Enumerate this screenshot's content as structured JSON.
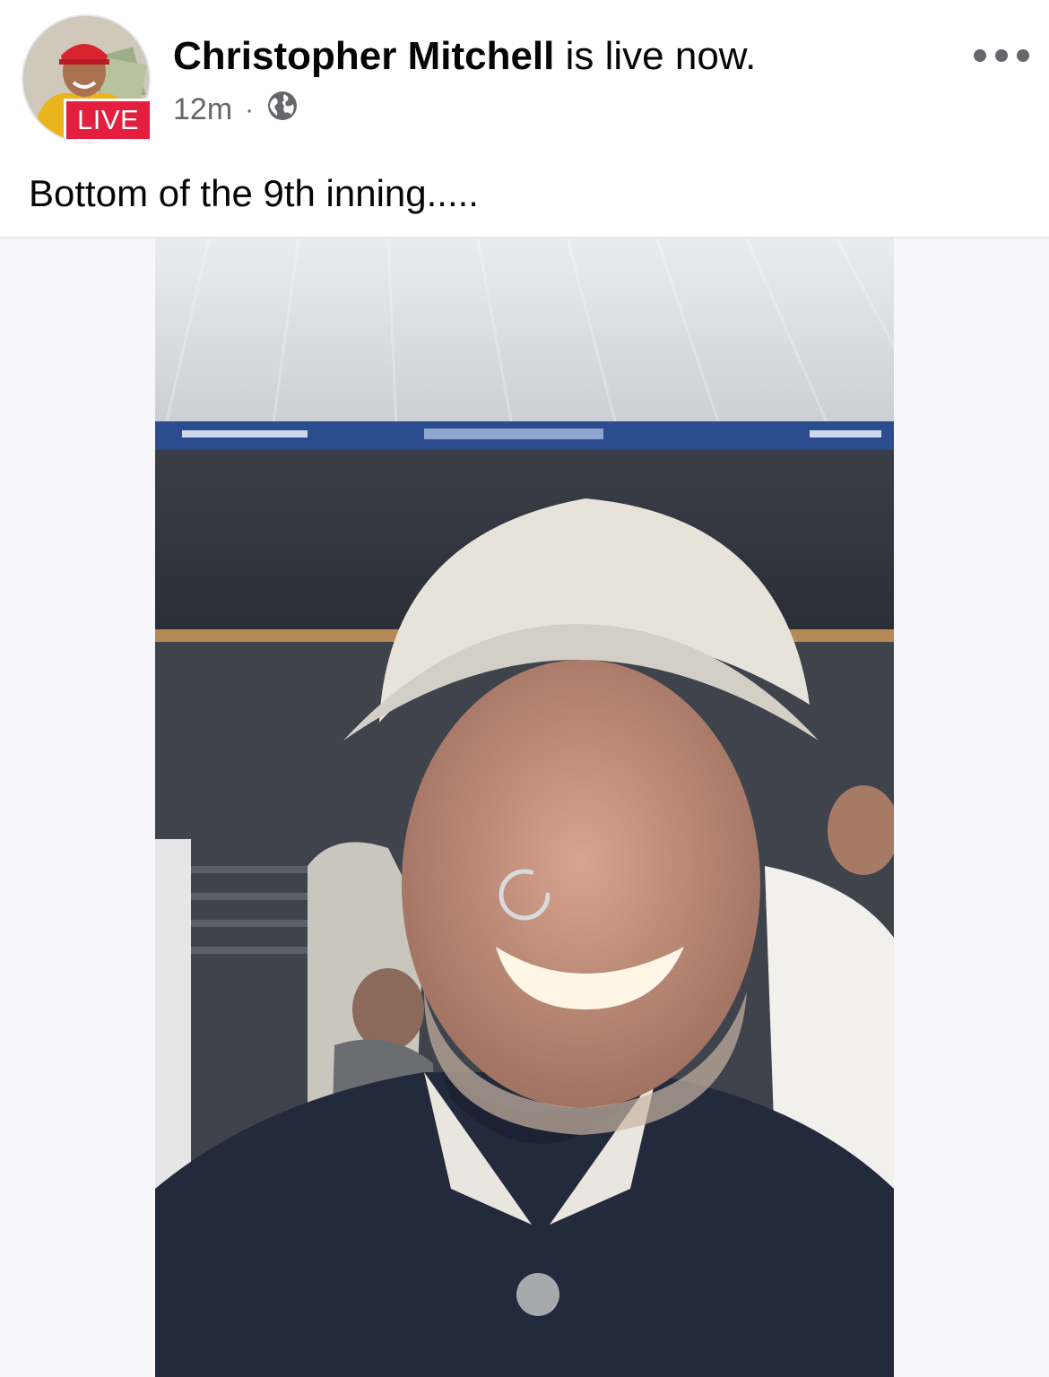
{
  "post": {
    "author_name": "Christopher Mitchell",
    "status_text": "is live now.",
    "live_badge": "LIVE",
    "time_ago": "12m",
    "separator": "·",
    "privacy_icon": "globe-icon",
    "caption": "Bottom of the 9th inning....."
  },
  "more_icon": "more-horizontal-icon",
  "video": {
    "loading_icon": "loading-spinner-icon"
  },
  "colors": {
    "live_red": "#e41e3f",
    "text_primary": "#050505",
    "text_secondary": "#65676b"
  }
}
